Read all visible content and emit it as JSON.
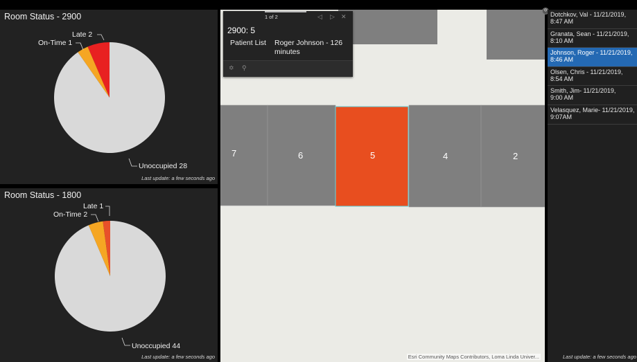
{
  "widgets": {
    "room2900": {
      "title": "Room Status - 2900",
      "last_update": "Last update: a few seconds ago",
      "slices": [
        {
          "label": "Late 2",
          "value": 2,
          "color": "#e82121"
        },
        {
          "label": "On-Time 1",
          "value": 1,
          "color": "#f5a623"
        },
        {
          "label": "Unoccupied 28",
          "value": 28,
          "color": "#d9d9d9"
        }
      ]
    },
    "room1800": {
      "title": "Room Status - 1800",
      "last_update": "Last update: a few seconds ago",
      "slices": [
        {
          "label": "Late 1",
          "value": 1,
          "color": "#e8502a"
        },
        {
          "label": "On-Time 2",
          "value": 2,
          "color": "#f5a623"
        },
        {
          "label": "Unoccupied 44",
          "value": 44,
          "color": "#d9d9d9"
        }
      ]
    }
  },
  "chart_data": [
    {
      "type": "pie",
      "title": "Room Status - 2900",
      "categories": [
        "Late",
        "On-Time",
        "Unoccupied"
      ],
      "values": [
        2,
        1,
        28
      ],
      "colors": [
        "#e82121",
        "#f5a623",
        "#d9d9d9"
      ]
    },
    {
      "type": "pie",
      "title": "Room Status - 1800",
      "categories": [
        "Late",
        "On-Time",
        "Unoccupied"
      ],
      "values": [
        1,
        2,
        44
      ],
      "colors": [
        "#e8502a",
        "#f5a623",
        "#d9d9d9"
      ]
    }
  ],
  "map": {
    "rooms": [
      "7",
      "6",
      "5",
      "4",
      "2"
    ],
    "selected_room": "5",
    "selected_color": "#e84e1f",
    "attribution": "Esri Community Maps Contributors, Loma Linda Univer..."
  },
  "popup": {
    "pager": "1 of 2",
    "title": "2900: 5",
    "field_label": "Patient List",
    "field_value": "Roger Johnson - 126 minutes",
    "icons": [
      "prev-icon",
      "next-icon",
      "close-icon",
      "move-icon",
      "zoom-to-icon"
    ]
  },
  "patient_list": {
    "items": [
      {
        "line1": "Dotchkov, Val - 11/21/2019,",
        "line2": "8:47 AM",
        "selected": false
      },
      {
        "line1": "Granata, Sean - 11/21/2019,",
        "line2": "8:10 AM",
        "selected": false
      },
      {
        "line1": "Johnson, Roger - 11/21/2019,",
        "line2": "8:46 AM",
        "selected": true
      },
      {
        "line1": "Olsen, Chris - 11/21/2019,",
        "line2": "8:54 AM",
        "selected": false
      },
      {
        "line1": "Smith, Jim- 11/21/2019,",
        "line2": "9:00 AM",
        "selected": false
      },
      {
        "line1": "Velasquez, Marie- 11/21/2019,",
        "line2": "9:07AM",
        "selected": false
      }
    ],
    "last_update": "Last update: a few seconds ago"
  }
}
